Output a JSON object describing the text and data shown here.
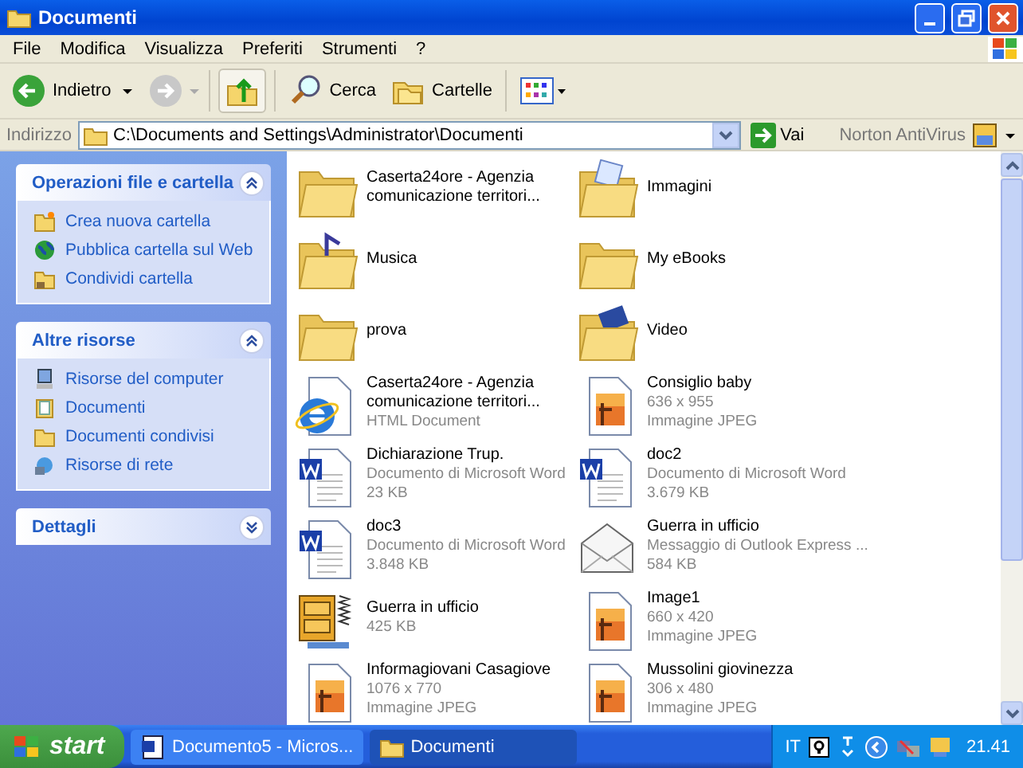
{
  "window": {
    "title": "Documenti"
  },
  "menu": [
    "File",
    "Modifica",
    "Visualizza",
    "Preferiti",
    "Strumenti",
    "?"
  ],
  "toolbar": {
    "back": "Indietro",
    "search": "Cerca",
    "folders": "Cartelle"
  },
  "address": {
    "label": "Indirizzo",
    "value": "C:\\Documents and Settings\\Administrator\\Documenti",
    "go": "Vai",
    "extra": "Norton AntiVirus"
  },
  "sidebar": [
    {
      "title": "Operazioni file e cartella",
      "expanded": true,
      "items": [
        {
          "label": "Crea nuova cartella",
          "kind": "newfolder"
        },
        {
          "label": "Pubblica cartella sul Web",
          "kind": "globe"
        },
        {
          "label": "Condividi cartella",
          "kind": "share"
        }
      ]
    },
    {
      "title": "Altre risorse",
      "expanded": true,
      "items": [
        {
          "label": "Risorse del computer",
          "kind": "computer"
        },
        {
          "label": "Documenti",
          "kind": "documents"
        },
        {
          "label": "Documenti condivisi",
          "kind": "folder"
        },
        {
          "label": "Risorse di rete",
          "kind": "network"
        }
      ]
    },
    {
      "title": "Dettagli",
      "expanded": false
    }
  ],
  "files": [
    {
      "name": "Caserta24ore - Agenzia comunicazione territori...",
      "kind": "folder"
    },
    {
      "name": "Immagini",
      "kind": "pictures"
    },
    {
      "name": "Musica",
      "kind": "music"
    },
    {
      "name": "My eBooks",
      "kind": "folder"
    },
    {
      "name": "prova",
      "kind": "folder"
    },
    {
      "name": "Video",
      "kind": "video"
    },
    {
      "name": "Caserta24ore - Agenzia comunicazione territori...",
      "kind": "html",
      "details": [
        "HTML Document"
      ]
    },
    {
      "name": "Consiglio baby",
      "kind": "image",
      "details": [
        "636 x 955",
        "Immagine JPEG"
      ]
    },
    {
      "name": "Dichiarazione Trup.",
      "kind": "word",
      "details": [
        "Documento di Microsoft Word",
        "23 KB"
      ]
    },
    {
      "name": "doc2",
      "kind": "word",
      "details": [
        "Documento di Microsoft Word",
        "3.679 KB"
      ]
    },
    {
      "name": "doc3",
      "kind": "word",
      "details": [
        "Documento di Microsoft Word",
        "3.848 KB"
      ]
    },
    {
      "name": "Guerra in ufficio",
      "kind": "mail",
      "details": [
        "Messaggio di Outlook Express ...",
        "584 KB"
      ]
    },
    {
      "name": "Guerra in ufficio",
      "kind": "zip",
      "details": [
        "425 KB"
      ]
    },
    {
      "name": "Image1",
      "kind": "image",
      "details": [
        "660 x 420",
        "Immagine JPEG"
      ]
    },
    {
      "name": "Informagiovani Casagiove",
      "kind": "image",
      "details": [
        "1076 x 770",
        "Immagine JPEG"
      ]
    },
    {
      "name": "Mussolini giovinezza",
      "kind": "image",
      "details": [
        "306 x 480",
        "Immagine JPEG"
      ]
    }
  ],
  "taskbar": {
    "start": "start",
    "tasks": [
      {
        "label": "Documento5 - Micros...",
        "kind": "word",
        "selected": false
      },
      {
        "label": "Documenti",
        "kind": "folder",
        "selected": true
      }
    ],
    "language": "IT",
    "clock": "21.41"
  }
}
